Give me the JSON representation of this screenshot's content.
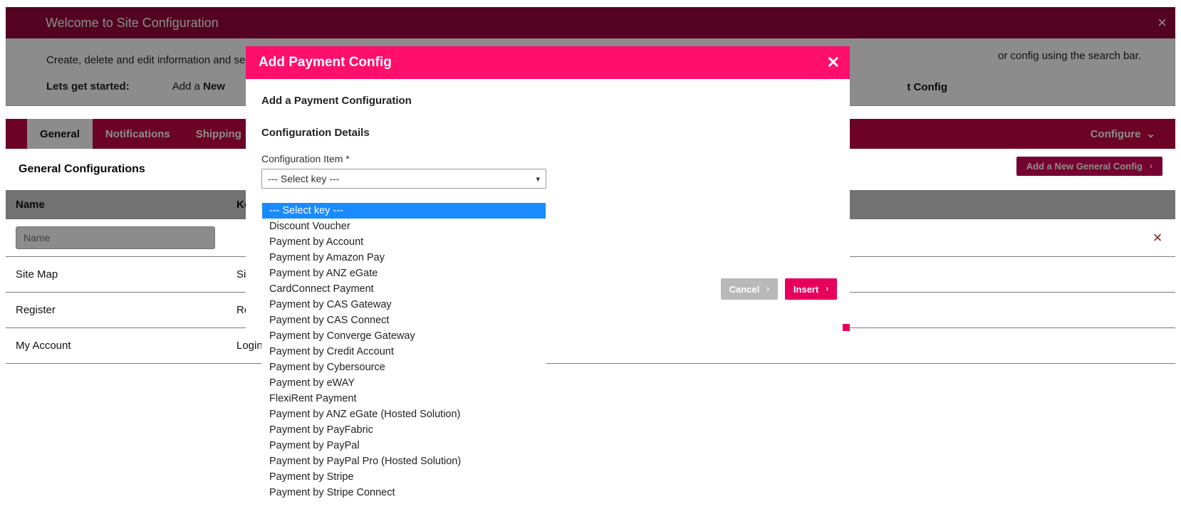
{
  "banner": {
    "title": "Welcome to Site Configuration"
  },
  "intro": {
    "line1_left": "Create, delete and edit information and se",
    "line1_right": "or config using the search bar.",
    "start_label": "Lets get started:",
    "adda": "Add a ",
    "adda_bold": "New ",
    "right_bold_tail": "t Config"
  },
  "tabs": {
    "active": "General",
    "items": [
      "Notifications",
      "Shipping"
    ],
    "configure": "Configure"
  },
  "section": {
    "title": "General Configurations",
    "add_btn": "Add a New General Config"
  },
  "table": {
    "cols": [
      "Name",
      "Ke"
    ],
    "filter_placeholder": "Name",
    "rows": [
      {
        "name": "Site Map",
        "key": "Siten"
      },
      {
        "name": "Register",
        "key": "Regis"
      },
      {
        "name": "My Account",
        "key": "Login Pa"
      }
    ]
  },
  "modal": {
    "title": "Add Payment Config",
    "heading": "Add a Payment Configuration",
    "section": "Configuration Details",
    "field_label": "Configuration Item *",
    "selected": "--- Select key ---",
    "cancel": "Cancel",
    "insert": "Insert",
    "options": [
      "--- Select key ---",
      "Discount Voucher",
      "Payment by Account",
      "Payment by Amazon Pay",
      "Payment by ANZ eGate",
      "CardConnect Payment",
      "Payment by CAS Gateway",
      "Payment by CAS Connect",
      "Payment by Converge Gateway",
      "Payment by Credit Account",
      "Payment by Cybersource",
      "Payment by eWAY",
      "FlexiRent Payment",
      "Payment by ANZ eGate (Hosted Solution)",
      "Payment by PayFabric",
      "Payment by PayPal",
      "Payment by PayPal Pro (Hosted Solution)",
      "Payment by Stripe",
      "Payment by Stripe Connect"
    ]
  }
}
